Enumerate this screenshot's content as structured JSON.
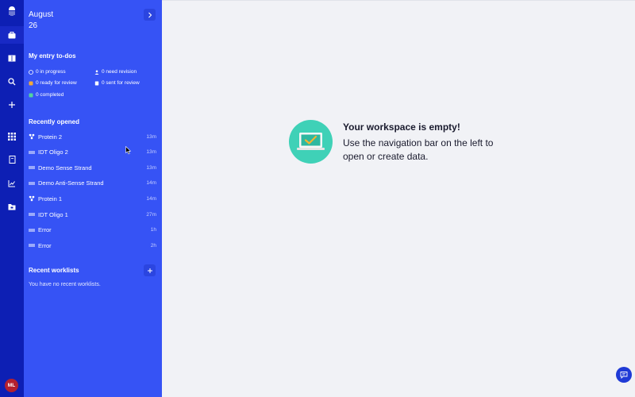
{
  "rail": {
    "icons": [
      "jellyfish-logo-icon",
      "briefcase-icon",
      "notebook-icon",
      "search-icon",
      "plus-icon",
      "grid-icon",
      "document-icon",
      "chart-icon",
      "folder-icon"
    ],
    "avatar": "ML"
  },
  "panel": {
    "month": "August",
    "day": "26",
    "todos_title": "My entry to-dos",
    "todos": {
      "in_progress": "0 in progress",
      "need_revision": "0 need revision",
      "ready_for_review": "0 ready for review",
      "sent_for_review": "0 sent for review",
      "completed": "0 completed"
    },
    "recent_title": "Recently opened",
    "recent": [
      {
        "name": "Protein 2",
        "time": "13m",
        "icon": "protein-icon"
      },
      {
        "name": "IDT Oligo 2",
        "time": "13m",
        "icon": "sequence-icon"
      },
      {
        "name": "Demo Sense Strand",
        "time": "13m",
        "icon": "sequence-icon"
      },
      {
        "name": "Demo Anti-Sense Strand",
        "time": "14m",
        "icon": "sequence-icon"
      },
      {
        "name": "Protein 1",
        "time": "14m",
        "icon": "protein-icon"
      },
      {
        "name": "IDT Oligo 1",
        "time": "27m",
        "icon": "sequence-icon"
      },
      {
        "name": "Error",
        "time": "1h",
        "icon": "sequence-icon"
      },
      {
        "name": "Error",
        "time": "2h",
        "icon": "sequence-icon"
      }
    ],
    "worklists_title": "Recent worklists",
    "worklists_empty": "You have no recent worklists."
  },
  "main": {
    "title": "Your workspace is empty!",
    "subtitle_line1": "Use the navigation bar on the left to",
    "subtitle_line2": "open or create data."
  },
  "colors": {
    "rail": "#0d1fb4",
    "panel": "#3653f5",
    "accent": "#3fd1b7",
    "avatar": "#b3202f"
  }
}
